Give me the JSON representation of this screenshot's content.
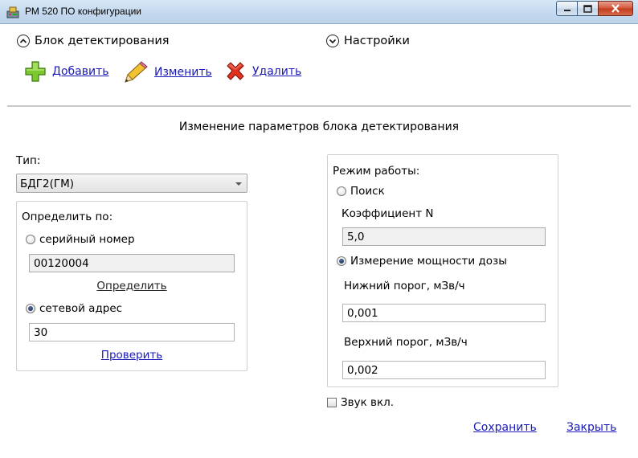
{
  "window": {
    "title": "РМ 520 ПО конфигурации"
  },
  "expanders": {
    "detection_block": "Блок детектирования",
    "settings": "Настройки"
  },
  "toolbar": {
    "add_label": "Добавить",
    "edit_label": "Изменить",
    "delete_label": "Удалить"
  },
  "form": {
    "heading": "Изменение параметров блока детектирования",
    "type_label": "Тип:",
    "type_value": "БДГ2(ГМ)",
    "determine_by": {
      "title": "Определить по:",
      "serial_label": "серийный номер",
      "serial_selected": false,
      "serial_value": "00120004",
      "determine_link": "Определить",
      "address_label": "сетевой адрес",
      "address_selected": true,
      "address_value": "30",
      "check_link": "Проверить"
    },
    "mode": {
      "title": "Режим работы:",
      "search_label": "Поиск",
      "search_selected": false,
      "coef_label": "Коэффициент N",
      "coef_value": "5,0",
      "dose_label": "Измерение мощности дозы",
      "dose_selected": true,
      "lower_label": "Нижний порог, мЗв/ч",
      "lower_value": "0,001",
      "upper_label": "Верхний порог, мЗв/ч",
      "upper_value": "0,002"
    },
    "sound_label": "Звук вкл.",
    "sound_checked": false
  },
  "actions": {
    "save_label": "Сохранить",
    "close_label": "Закрыть"
  },
  "icons": {
    "add": "plus-icon",
    "edit": "pencil-icon",
    "delete": "red-x-icon",
    "expand_up": "chevron-up-circle-icon",
    "expand_down": "chevron-down-circle-icon"
  }
}
